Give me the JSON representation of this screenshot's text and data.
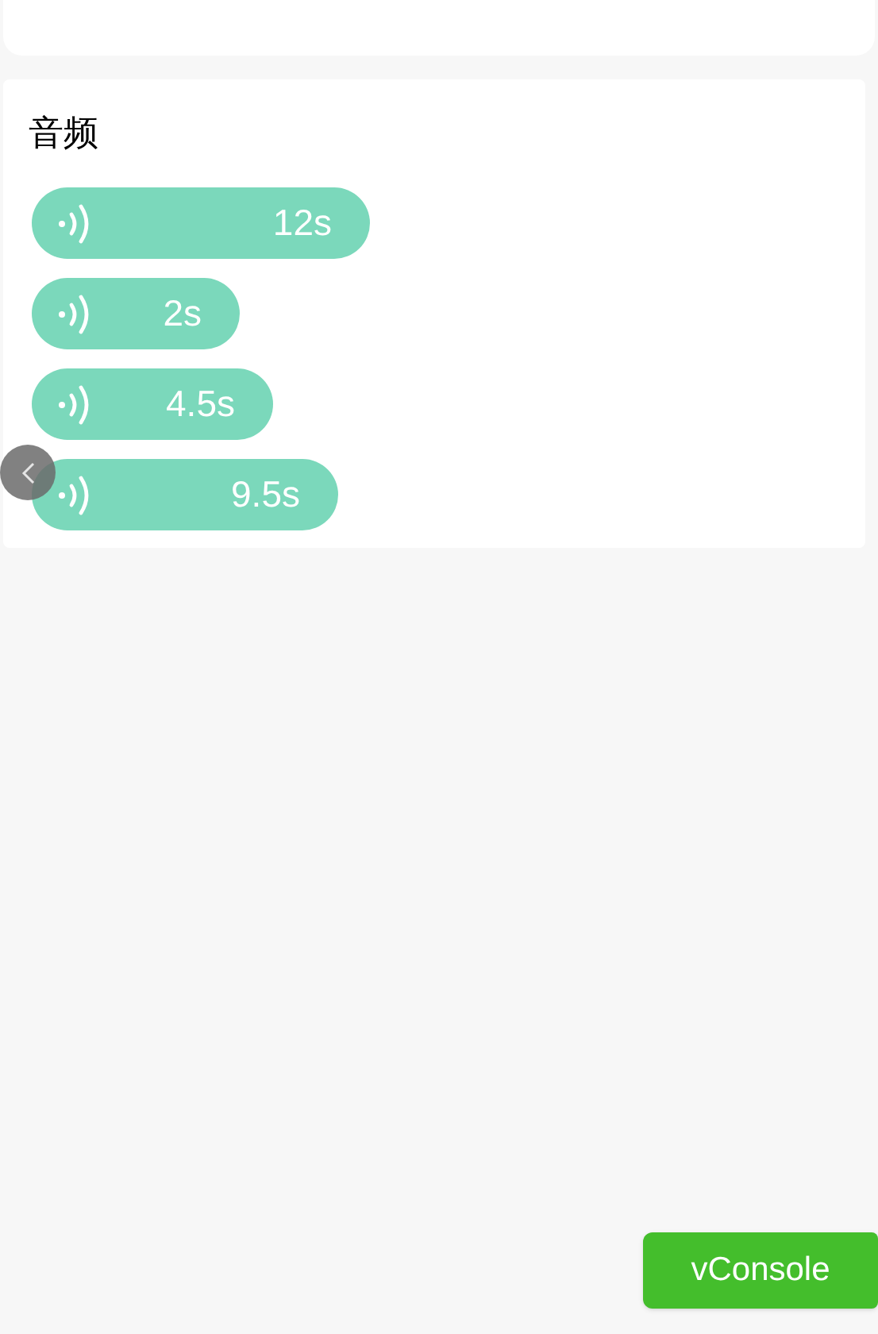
{
  "section": {
    "title": "音频",
    "audio_messages": [
      {
        "duration": "12s"
      },
      {
        "duration": "2s"
      },
      {
        "duration": "4.5s"
      },
      {
        "duration": "9.5s"
      }
    ]
  },
  "floating_button": {
    "label": "vConsole"
  }
}
